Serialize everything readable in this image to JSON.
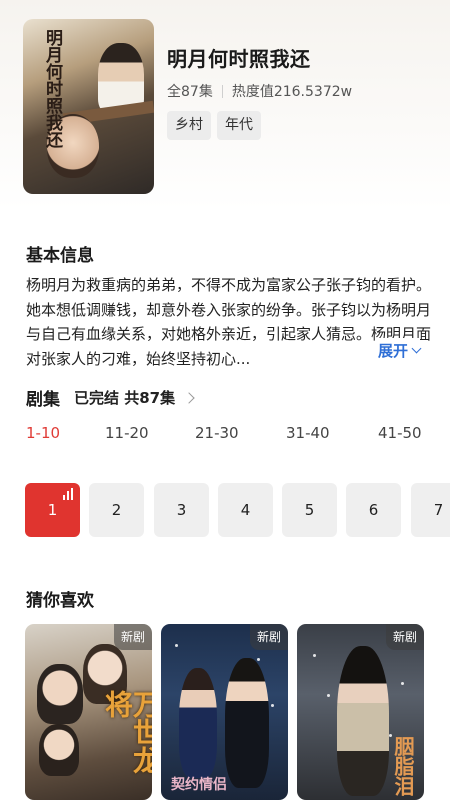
{
  "drama": {
    "title": "明月何时照我还",
    "episodes_total": "全87集",
    "heat": "热度值216.5372w",
    "tags": [
      "乡村",
      "年代"
    ],
    "poster_title": "明月何时照我还"
  },
  "basic_info": {
    "heading": "基本信息",
    "description": "杨明月为救重病的弟弟，不得不成为富家公子张子钧的看护。她本想低调赚钱，却意外卷入张家的纷争。张子钧以为杨明月与自己有血缘关系，对她格外亲近，引起家人猜忌。杨明月面对张家人的刁难，始终坚持初心...",
    "expand_label": "展开"
  },
  "episodes": {
    "heading": "剧集",
    "status": "已完结 共87集",
    "ranges": [
      "1-10",
      "11-20",
      "21-30",
      "31-40",
      "41-50"
    ],
    "active_range": 0,
    "items": [
      "1",
      "2",
      "3",
      "4",
      "5",
      "6",
      "7"
    ],
    "active_item": 0
  },
  "recommend": {
    "heading": "猜你喜欢",
    "items": [
      {
        "badge": "新剧",
        "poster_text": "万世龙将"
      },
      {
        "badge": "新剧",
        "poster_text": "契约情侣"
      },
      {
        "badge": "新剧",
        "poster_text": "胭脂泪"
      }
    ]
  },
  "colors": {
    "accent_red": "#e0342f",
    "link_blue": "#2f6fd6",
    "chip_gray": "#efefef"
  }
}
